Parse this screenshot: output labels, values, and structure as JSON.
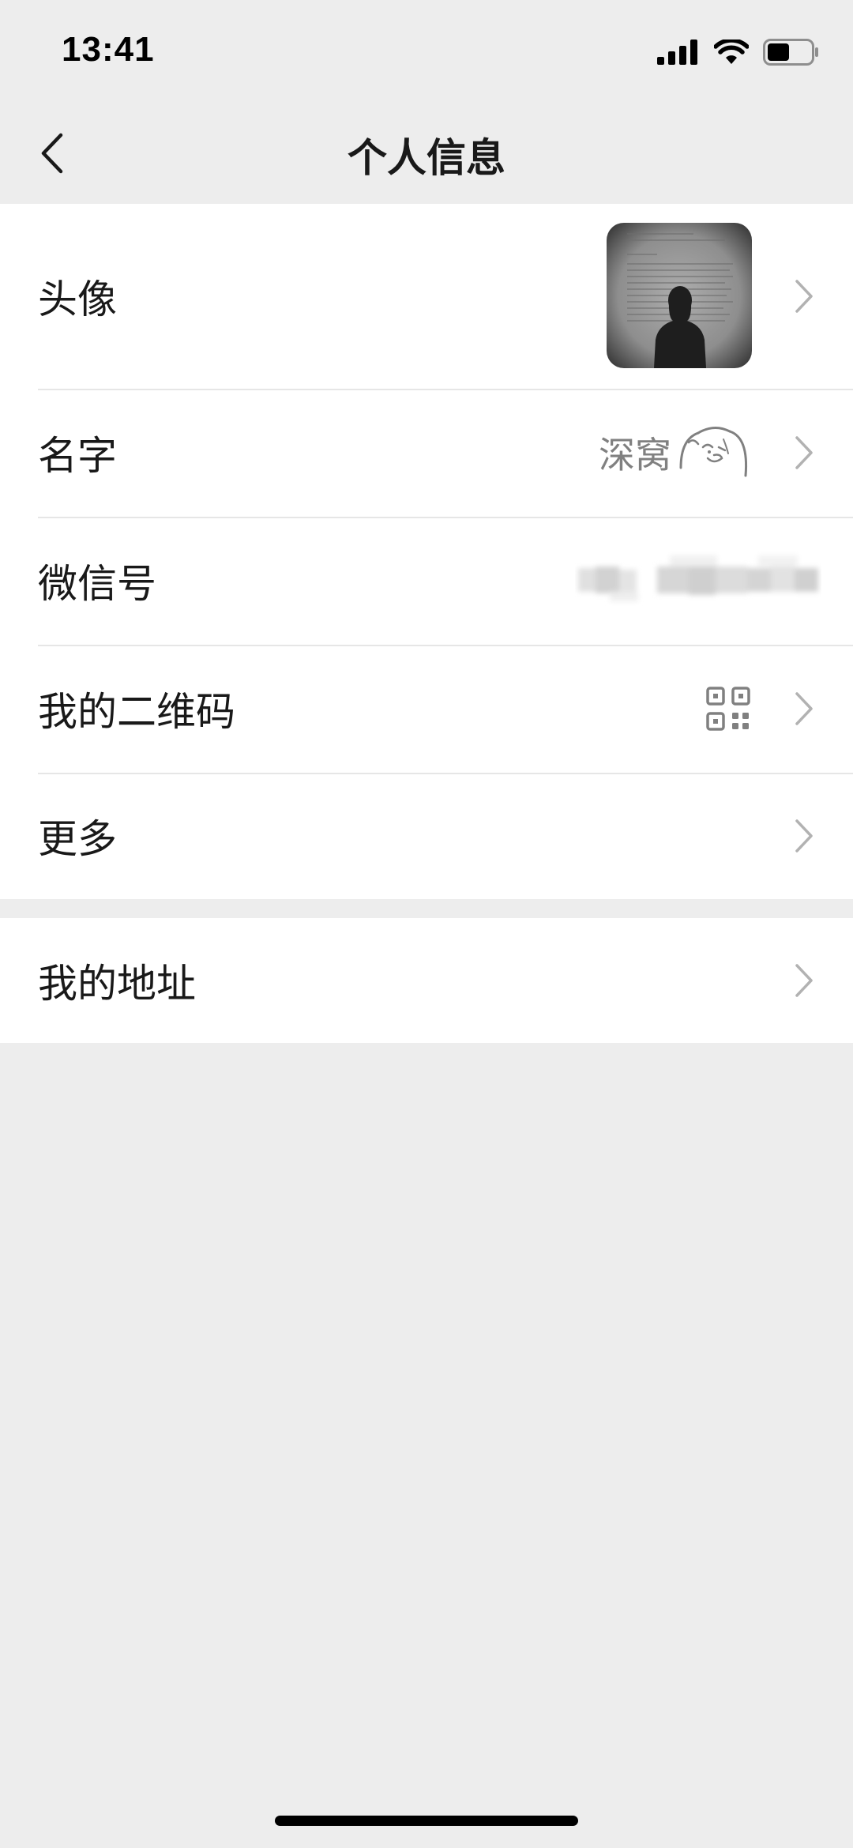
{
  "status_bar": {
    "time": "13:41",
    "icons": [
      "signal-icon",
      "wifi-icon",
      "battery-icon"
    ],
    "battery_level": 0.5
  },
  "nav": {
    "back_icon": "chevron-left-icon",
    "title": "个人信息"
  },
  "profile_group": {
    "avatar_row": {
      "label": "头像",
      "value_type": "image"
    },
    "name_row": {
      "label": "名字",
      "value": "深窝",
      "emoji": "face-doodle-icon"
    },
    "wechat_id_row": {
      "label": "微信号",
      "value_type": "blurred"
    },
    "qr_row": {
      "label": "我的二维码",
      "icon": "qr-code-icon"
    },
    "more_row": {
      "label": "更多"
    }
  },
  "address_group": {
    "address_row": {
      "label": "我的地址"
    }
  },
  "colors": {
    "background": "#EDEDED",
    "card": "#FFFFFF",
    "text": "#191919",
    "secondary_text": "#808080",
    "chevron": "#B2B2B2",
    "divider": "#E6E6E6"
  }
}
